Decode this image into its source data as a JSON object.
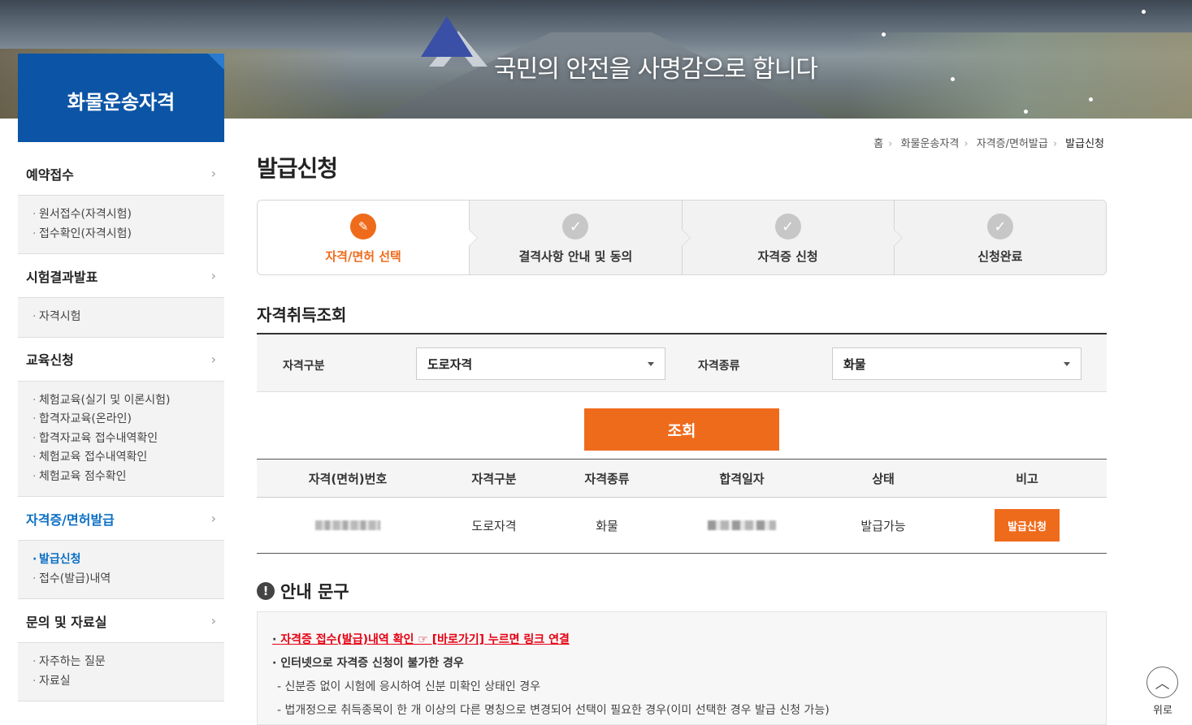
{
  "banner": {
    "slogan": "국민의 안전을 사명감으로 합니다"
  },
  "brand": {
    "title": "화물운송자격"
  },
  "sidebar": {
    "groups": [
      {
        "label": "예약접수",
        "items": [
          "원서접수(자격시험)",
          "접수확인(자격시험)"
        ]
      },
      {
        "label": "시험결과발표",
        "items": [
          "자격시험"
        ]
      },
      {
        "label": "교육신청",
        "items": [
          "체험교육(실기 및 이론시험)",
          "합격자교육(온라인)",
          "합격자교육 접수내역확인",
          "체험교육 접수내역확인",
          "체험교육 점수확인"
        ]
      },
      {
        "label": "자격증/면허발급",
        "items": [
          "발급신청",
          "접수(발급)내역"
        ]
      },
      {
        "label": "문의 및 자료실",
        "items": [
          "자주하는 질문",
          "자료실"
        ]
      }
    ],
    "chevron": "›"
  },
  "breadcrumb": [
    "홈",
    "화물운송자격",
    "자격증/면허발급",
    "발급신청"
  ],
  "page_title": "발급신청",
  "steps": [
    "자격/면허 선택",
    "결격사항 안내 및 동의",
    "자격증 신청",
    "신청완료"
  ],
  "lookup": {
    "title": "자격취득조회",
    "category_label": "자격구분",
    "category_value": "도로자격",
    "type_label": "자격종류",
    "type_value": "화물",
    "search_button": "조회"
  },
  "table": {
    "headers": [
      "자격(면허)번호",
      "자격구분",
      "자격종류",
      "합격일자",
      "상태",
      "비고"
    ],
    "rows": [
      {
        "category": "도로자격",
        "type": "화물",
        "status": "발급가능",
        "action": "발급신청"
      }
    ]
  },
  "notice": {
    "title": "안내 문구",
    "link_text": "자격증 접수(발급)내역 확인 ☞ [바로가기] 누르면 링크 연결",
    "line1": "· 인터넷으로 자격증 신청이 불가한 경우",
    "line2": "- 신분증 없이 시험에 응시하여 신분 미확인 상태인 경우",
    "line3": "- 법개정으로 취득종목이 한 개 이상의 다른 명칭으로 변경되어 선택이 필요한 경우(이미 선택한 경우 발급 신청 가능)"
  },
  "top_button": {
    "label": "위로"
  },
  "colors": {
    "brand": "#0b54a6",
    "accent": "#ef6b1c",
    "active_nav": "#0b6fc4"
  }
}
